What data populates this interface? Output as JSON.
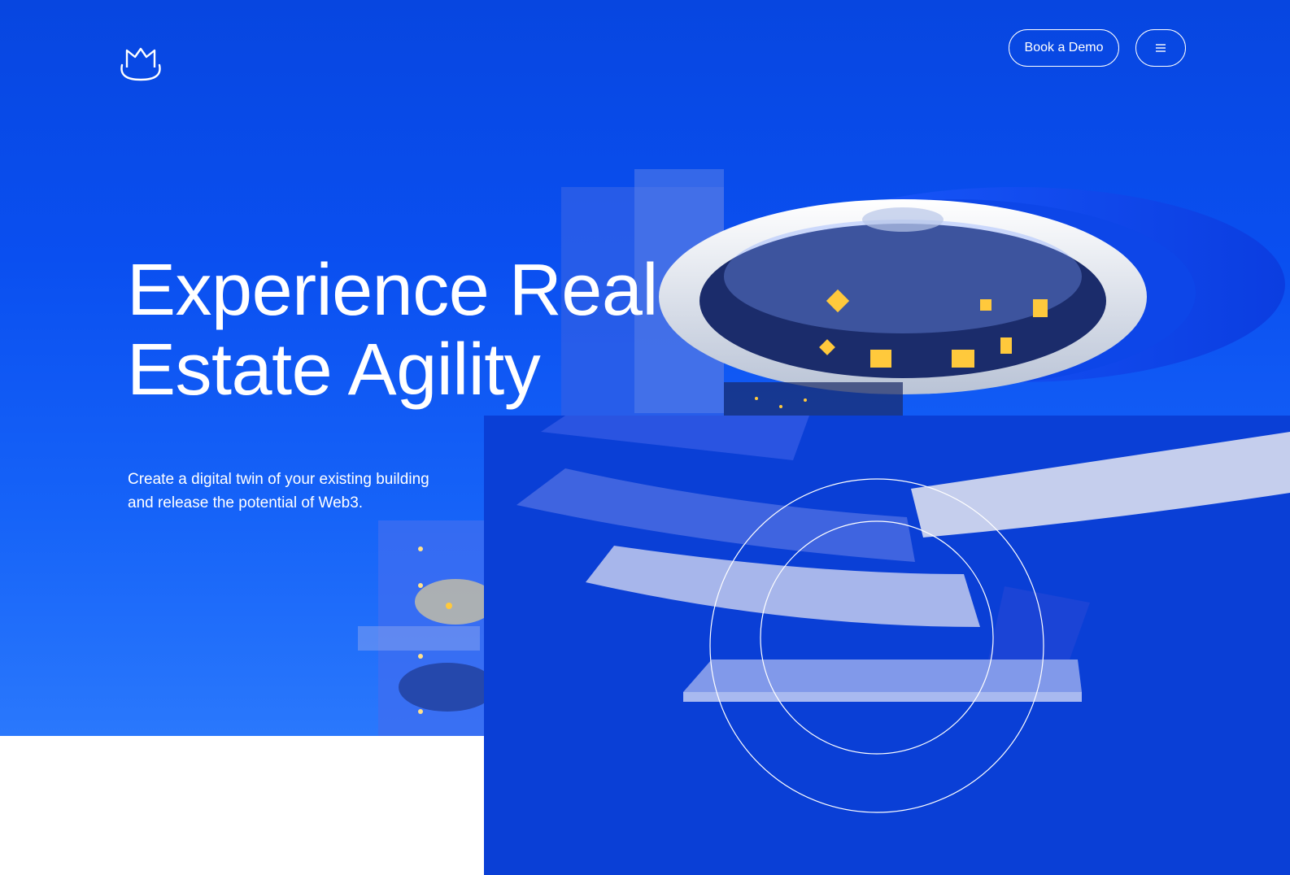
{
  "header": {
    "logo_icon": "m-crown-logo-icon",
    "book_demo_label": "Book a Demo",
    "menu_icon": "hamburger-menu-icon"
  },
  "hero": {
    "headline_line1": "Experience Real",
    "headline_line2": "Estate Agility",
    "subtext_line1": "Create a digital twin of your existing building",
    "subtext_line2": "and release the potential of Web3."
  },
  "colors": {
    "hero_blue": "#0a4ff0",
    "panel_blue": "#0a3fd6",
    "accent_yellow": "#ffc93c",
    "white": "#ffffff"
  }
}
